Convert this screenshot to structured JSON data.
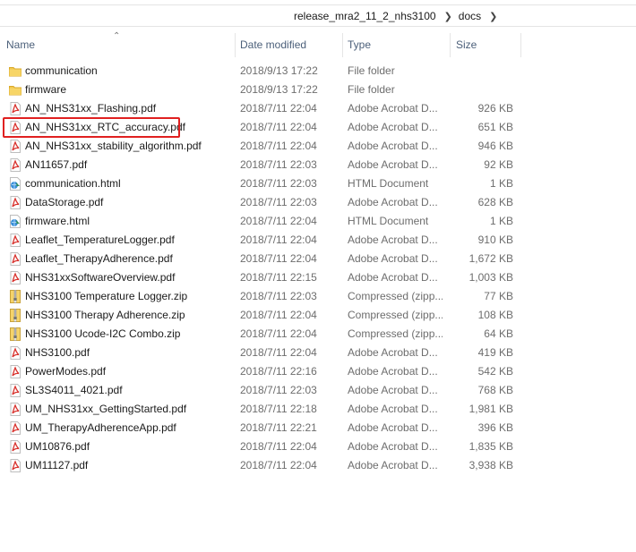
{
  "breadcrumb": {
    "parent": "release_mra2_11_2_nhs3100",
    "current": "docs"
  },
  "columns": {
    "name": "Name",
    "date": "Date modified",
    "type": "Type",
    "size": "Size"
  },
  "files": [
    {
      "name": "communication",
      "date": "2018/9/13 17:22",
      "type": "File folder",
      "size": "",
      "icon": "folder"
    },
    {
      "name": "firmware",
      "date": "2018/9/13 17:22",
      "type": "File folder",
      "size": "",
      "icon": "folder"
    },
    {
      "name": "AN_NHS31xx_Flashing.pdf",
      "date": "2018/7/11 22:04",
      "type": "Adobe Acrobat D...",
      "size": "926 KB",
      "icon": "pdf"
    },
    {
      "name": "AN_NHS31xx_RTC_accuracy.pdf",
      "date": "2018/7/11 22:04",
      "type": "Adobe Acrobat D...",
      "size": "651 KB",
      "icon": "pdf"
    },
    {
      "name": "AN_NHS31xx_stability_algorithm.pdf",
      "date": "2018/7/11 22:04",
      "type": "Adobe Acrobat D...",
      "size": "946 KB",
      "icon": "pdf"
    },
    {
      "name": "AN11657.pdf",
      "date": "2018/7/11 22:03",
      "type": "Adobe Acrobat D...",
      "size": "92 KB",
      "icon": "pdf"
    },
    {
      "name": "communication.html",
      "date": "2018/7/11 22:03",
      "type": "HTML Document",
      "size": "1 KB",
      "icon": "html"
    },
    {
      "name": "DataStorage.pdf",
      "date": "2018/7/11 22:03",
      "type": "Adobe Acrobat D...",
      "size": "628 KB",
      "icon": "pdf"
    },
    {
      "name": "firmware.html",
      "date": "2018/7/11 22:04",
      "type": "HTML Document",
      "size": "1 KB",
      "icon": "html"
    },
    {
      "name": "Leaflet_TemperatureLogger.pdf",
      "date": "2018/7/11 22:04",
      "type": "Adobe Acrobat D...",
      "size": "910 KB",
      "icon": "pdf"
    },
    {
      "name": "Leaflet_TherapyAdherence.pdf",
      "date": "2018/7/11 22:04",
      "type": "Adobe Acrobat D...",
      "size": "1,672 KB",
      "icon": "pdf"
    },
    {
      "name": "NHS31xxSoftwareOverview.pdf",
      "date": "2018/7/11 22:15",
      "type": "Adobe Acrobat D...",
      "size": "1,003 KB",
      "icon": "pdf"
    },
    {
      "name": "NHS3100 Temperature Logger.zip",
      "date": "2018/7/11 22:03",
      "type": "Compressed (zipp...",
      "size": "77 KB",
      "icon": "zip"
    },
    {
      "name": "NHS3100 Therapy Adherence.zip",
      "date": "2018/7/11 22:04",
      "type": "Compressed (zipp...",
      "size": "108 KB",
      "icon": "zip"
    },
    {
      "name": "NHS3100 Ucode-I2C Combo.zip",
      "date": "2018/7/11 22:04",
      "type": "Compressed (zipp...",
      "size": "64 KB",
      "icon": "zip"
    },
    {
      "name": "NHS3100.pdf",
      "date": "2018/7/11 22:04",
      "type": "Adobe Acrobat D...",
      "size": "419 KB",
      "icon": "pdf"
    },
    {
      "name": "PowerModes.pdf",
      "date": "2018/7/11 22:16",
      "type": "Adobe Acrobat D...",
      "size": "542 KB",
      "icon": "pdf"
    },
    {
      "name": "SL3S4011_4021.pdf",
      "date": "2018/7/11 22:03",
      "type": "Adobe Acrobat D...",
      "size": "768 KB",
      "icon": "pdf"
    },
    {
      "name": "UM_NHS31xx_GettingStarted.pdf",
      "date": "2018/7/11 22:18",
      "type": "Adobe Acrobat D...",
      "size": "1,981 KB",
      "icon": "pdf"
    },
    {
      "name": "UM_TherapyAdherenceApp.pdf",
      "date": "2018/7/11 22:21",
      "type": "Adobe Acrobat D...",
      "size": "396 KB",
      "icon": "pdf"
    },
    {
      "name": "UM10876.pdf",
      "date": "2018/7/11 22:04",
      "type": "Adobe Acrobat D...",
      "size": "1,835 KB",
      "icon": "pdf"
    },
    {
      "name": "UM11127.pdf",
      "date": "2018/7/11 22:04",
      "type": "Adobe Acrobat D...",
      "size": "3,938 KB",
      "icon": "pdf"
    }
  ],
  "highlighted_file": "AN_NHS31xx_RTC_accuracy.pdf",
  "colors": {
    "highlight": "#e02020",
    "header_text": "#4c607a",
    "folder": "#f2c84b",
    "pdf": "#d8312c"
  }
}
